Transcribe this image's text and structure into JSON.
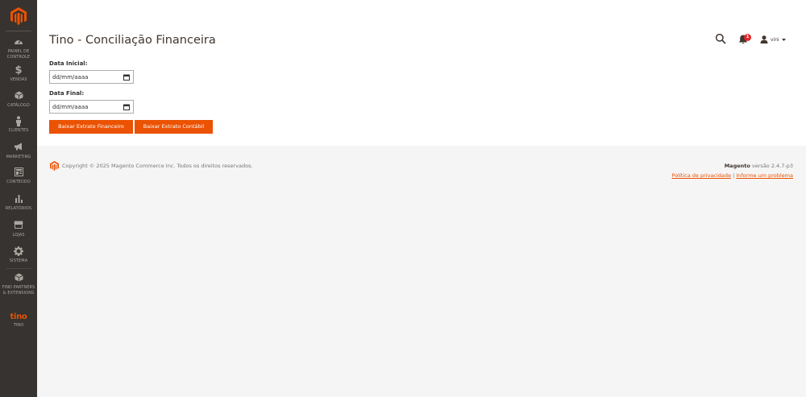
{
  "sidebar": {
    "items": [
      {
        "label_1": "PAINEL DE",
        "label_2": "CONTROLE",
        "icon": "dashboard-icon"
      },
      {
        "label_1": "VENDAS",
        "label_2": "",
        "icon": "dollar-icon"
      },
      {
        "label_1": "CATÁLOGO",
        "label_2": "",
        "icon": "cube-icon"
      },
      {
        "label_1": "CLIENTES",
        "label_2": "",
        "icon": "person-icon"
      },
      {
        "label_1": "MARKETING",
        "label_2": "",
        "icon": "megaphone-icon"
      },
      {
        "label_1": "CONTEÚDO",
        "label_2": "",
        "icon": "content-icon"
      },
      {
        "label_1": "RELATÓRIOS",
        "label_2": "",
        "icon": "bar-chart-icon"
      },
      {
        "label_1": "LOJAS",
        "label_2": "",
        "icon": "store-icon"
      },
      {
        "label_1": "SISTEMA",
        "label_2": "",
        "icon": "gear-icon"
      },
      {
        "label_1": "FIND PARTNERS",
        "label_2": "& EXTENSIONS",
        "icon": "extensions-icon"
      },
      {
        "mark": "tino",
        "label_1": "TINO",
        "label_2": ""
      }
    ]
  },
  "header": {
    "title": "Tino - Conciliação Financeira",
    "notifications_count": "1",
    "user_name": "vini"
  },
  "form": {
    "start_label": "Data Inicial:",
    "start_placeholder": "dd/mm/aaaa",
    "end_label": "Data Final:",
    "end_placeholder": "dd/mm/aaaa",
    "btn_financial": "Baixar Extrato Financeiro",
    "btn_accounting": "Baixar Extrato Contábil"
  },
  "footer": {
    "copyright": "Copyright © 2025 Magento Commerce Inc. Todos os direitos reservados.",
    "brand": "Magento",
    "version": " versão 2.4.7-p3",
    "privacy": "Política de privacidade",
    "separator": " | ",
    "report": "Informe um problema"
  },
  "colors": {
    "accent": "#eb5202",
    "sidebar_bg": "#373330",
    "badge": "#e22626"
  }
}
